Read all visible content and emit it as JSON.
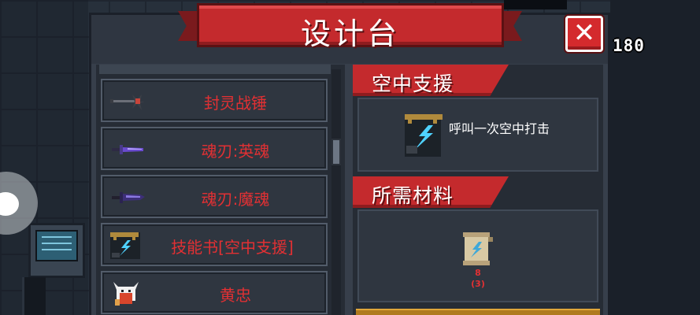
{
  "window": {
    "title": "设计台",
    "close_label": "✕"
  },
  "hud": {
    "counter": "180"
  },
  "recipe_list": [
    {
      "label": "封灵战锤",
      "icon": "hammer-icon"
    },
    {
      "label": "魂刃:英魂",
      "icon": "purple-sword-icon"
    },
    {
      "label": "魂刃:魔魂",
      "icon": "dark-sword-icon"
    },
    {
      "label": "技能书[空中支援]",
      "icon": "skill-book-icon"
    },
    {
      "label": "黄忠",
      "icon": "fox-character-icon"
    }
  ],
  "detail": {
    "item_name": "空中支援",
    "description": "呼叫一次空中打击",
    "materials_header": "所需材料",
    "material": {
      "icon": "scroll-icon",
      "count": "8",
      "owned": "(3)"
    }
  },
  "colors": {
    "accent_red": "#c42a2d",
    "label_red": "#e23033",
    "panel": "#262c35"
  }
}
